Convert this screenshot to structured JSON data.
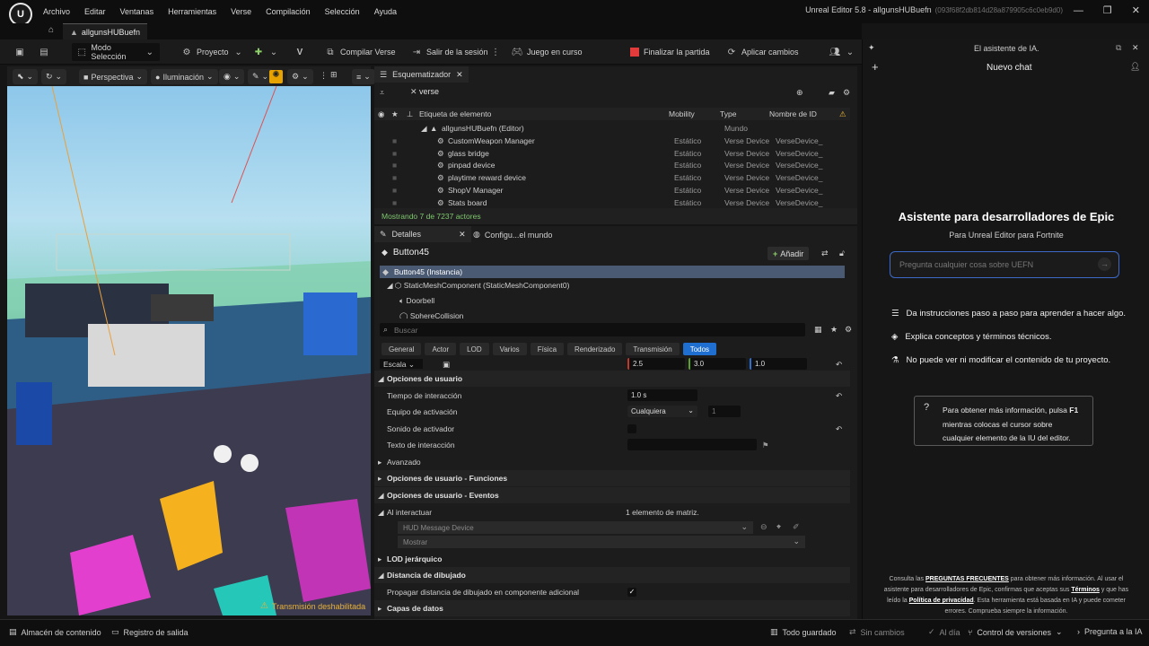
{
  "app": {
    "title": "Unreal Editor 5.8 - allgunsHUBuefn",
    "title_id": "(093f68f2db814d28a879905c6c0eb9d0)",
    "tab": "allgunsHUBuefn"
  },
  "menu": [
    "Archivo",
    "Editar",
    "Ventanas",
    "Herramientas",
    "Verse",
    "Compilación",
    "Selección",
    "Ayuda"
  ],
  "toolbar": {
    "mode": "Modo Selección",
    "project": "Proyecto",
    "compile": "Compilar Verse",
    "leave_session": "Salir de la sesión",
    "game_running": "Juego en curso",
    "end_match": "Finalizar la partida",
    "apply_changes": "Aplicar cambios"
  },
  "viewport": {
    "perspective": "Perspectiva",
    "lighting": "Iluminación",
    "warning": "Transmisión deshabilitada"
  },
  "outliner": {
    "tab": "Esquematizador",
    "search_value": "verse",
    "columns": [
      "Etiqueta de elemento",
      "Mobility",
      "Type",
      "Nombre de ID"
    ],
    "root": {
      "label": "allgunsHUBuefn (Editor)",
      "type": "Mundo"
    },
    "rows": [
      {
        "label": "CustomWeapon Manager",
        "mobility": "Estático",
        "type": "Verse Device",
        "id": "VerseDevice_"
      },
      {
        "label": "glass bridge",
        "mobility": "Estático",
        "type": "Verse Device",
        "id": "VerseDevice_"
      },
      {
        "label": "pinpad device",
        "mobility": "Estático",
        "type": "Verse Device",
        "id": "VerseDevice_"
      },
      {
        "label": "playtime reward device",
        "mobility": "Estático",
        "type": "Verse Device",
        "id": "VerseDevice_"
      },
      {
        "label": "ShopV Manager",
        "mobility": "Estático",
        "type": "Verse Device",
        "id": "VerseDevice_"
      },
      {
        "label": "Stats board",
        "mobility": "Estático",
        "type": "Verse Device",
        "id": "VerseDevice_"
      }
    ],
    "status": "Mostrando 7 de 7237 actores"
  },
  "details": {
    "tab": "Detalles",
    "tab2": "Configu...el mundo",
    "actor": "Button45",
    "add_label": "Añadir",
    "components": [
      "Button45 (Instancia)",
      "StaticMeshComponent (StaticMeshComponent0)",
      "Doorbell",
      "SphereCollision"
    ],
    "search_placeholder": "Buscar",
    "categories": [
      "General",
      "Actor",
      "LOD",
      "Varios",
      "Física",
      "Renderizado",
      "Transmisión",
      "Todos"
    ],
    "scale": {
      "label": "Escala",
      "x": "2.5",
      "y": "3.0",
      "z": "1.0"
    },
    "section_user": "Opciones de usuario",
    "interaction_time": {
      "label": "Tiempo de interacción",
      "value": "1.0 s"
    },
    "activation_team": {
      "label": "Equipo de activación",
      "value": "Cualquiera",
      "num": "1"
    },
    "activator_sound": {
      "label": "Sonido de activador"
    },
    "interaction_text": {
      "label": "Texto de interacción"
    },
    "advanced": "Avanzado",
    "user_functions": "Opciones de usuario - Funciones",
    "user_events": "Opciones de usuario - Eventos",
    "on_interact": {
      "label": "Al interactuar",
      "value": "1 elemento de matriz."
    },
    "hud_device": "HUD Message Device",
    "show": "Mostrar",
    "lod_hier": "LOD jerárquico",
    "draw_distance": "Distancia de dibujado",
    "propagate": "Propagar distancia de dibujado en componente adicional",
    "data_layers": "Capas de datos"
  },
  "ai": {
    "header": "El asistente de IA.",
    "new_chat": "Nuevo chat",
    "title": "Asistente para desarrolladores de Epic",
    "subtitle": "Para Unreal Editor para Fortnite",
    "placeholder": "Pregunta cualquier cosa sobre UEFN",
    "bullets": [
      "Da instrucciones paso a paso para aprender a hacer algo.",
      "Explica conceptos y términos técnicos.",
      "No puede ver ni modificar el contenido de tu proyecto."
    ],
    "tip_a": "Para obtener más información, pulsa ",
    "tip_key": "F1",
    "tip_b": "mientras colocas el cursor sobre",
    "tip_c": "cualquier elemento de la IU del editor.",
    "footer_1": "Consulta las ",
    "footer_faq": "PREGUNTAS FRECUENTES",
    "footer_2": " para obtener más información. Al usar el",
    "footer_3": "asistente para desarrolladores de Epic, confirmas que aceptas sus ",
    "footer_terms": "Términos",
    "footer_4": " y que has",
    "footer_5": "leído la ",
    "footer_privacy": "Política de privacidad",
    "footer_6": ". Esta herramienta está basada en IA y puede cometer",
    "footer_7": "errores. Comprueba siempre la información."
  },
  "status": {
    "content": "Almacén de contenido",
    "output": "Registro de salida",
    "saved": "Todo guardado",
    "no_changes": "Sin cambios",
    "up_to_date": "Al día",
    "version": "Control de versiones",
    "ask_ai": "Pregunta a la IA"
  },
  "colors": {
    "accent": "#1f6fd1",
    "end_red": "#e23b3b",
    "warning": "#e8b33a"
  }
}
